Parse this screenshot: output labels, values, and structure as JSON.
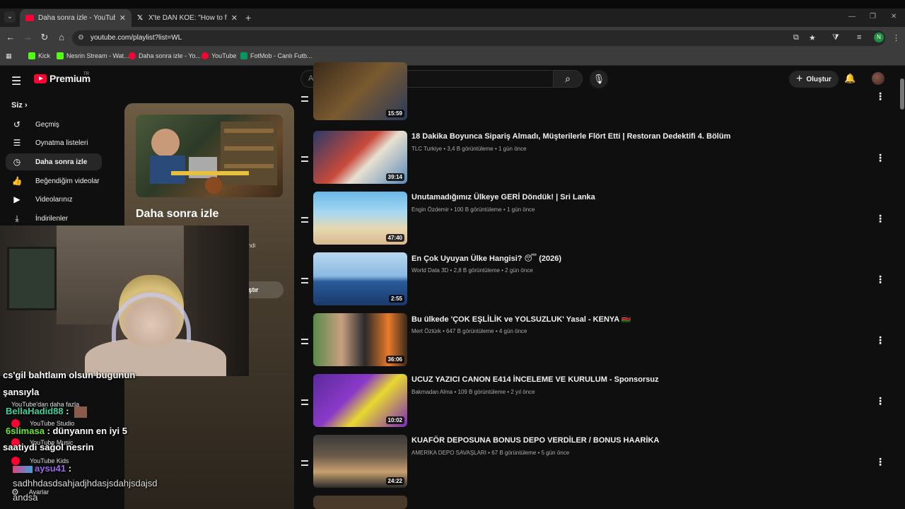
{
  "browser": {
    "tabs": [
      {
        "title": "Daha sonra izle - YouTube",
        "active": true
      },
      {
        "title": "X'te DAN KOE: \"How to fix your",
        "active": false
      }
    ],
    "url": "youtube.com/playlist?list=WL",
    "bookmarks": [
      "Kick",
      "Nesrin Stream - Wat...",
      "Daha sonra izle - Yo...",
      "YouTube",
      "FotMob - Canlı Futb..."
    ],
    "profile_initial": "N"
  },
  "youtube": {
    "logo": "Premium",
    "logo_region": "TR",
    "search_placeholder": "Ara",
    "create_label": "Oluştur",
    "sidebar": {
      "section": "Siz",
      "items": [
        {
          "label": "Geçmiş",
          "icon": "history-icon"
        },
        {
          "label": "Oynatma listeleri",
          "icon": "playlist-icon"
        },
        {
          "label": "Daha sonra izle",
          "icon": "clock-icon",
          "active": true
        },
        {
          "label": "Beğendiğim videolar",
          "icon": "thumbs-up-icon"
        },
        {
          "label": "Videolarınız",
          "icon": "video-icon"
        },
        {
          "label": "İndirilenler",
          "icon": "download-icon"
        }
      ],
      "more_from": "YouTube'dan daha fazla",
      "sub_items": [
        "YouTube Studio",
        "YouTube Music",
        "YouTube Kids"
      ],
      "settings": "Ayarlar"
    },
    "playlist": {
      "title": "Daha sonra izle",
      "meta_fragment": "endi",
      "shuffle_fragment": "ıştır"
    },
    "videos": [
      {
        "title": "",
        "meta": "",
        "duration": "15:59"
      },
      {
        "title": "18 Dakika Boyunca Sipariş Almadı, Müşterilerle Flört Etti | Restoran Dedektifi 4. Bölüm",
        "meta": "TLC Turkiye • 3,4 B görüntüleme • 1 gün önce",
        "duration": "39:14"
      },
      {
        "title": "Unutamadığımız Ülkeye GERİ Döndük! | Sri Lanka",
        "meta": "Engin Özdemir • 100 B görüntüleme • 1 gün önce",
        "duration": "47:40"
      },
      {
        "title": "En Çok Uyuyan Ülke Hangisi? 😴 (2026)",
        "meta": "World Data 3D • 2,8 B görüntüleme • 2 gün önce",
        "duration": "2:55"
      },
      {
        "title": "Bu ülkede 'ÇOK EŞLİLİK ve YOLSUZLUK' Yasal - KENYA 🇰🇪",
        "meta": "Mert Öztürk • 647 B görüntüleme • 4 gün önce",
        "duration": "36:06"
      },
      {
        "title": "UCUZ YAZICI CANON E414 İNCELEME VE KURULUM - Sponsorsuz",
        "meta": "Bakmadan Alma • 109 B görüntüleme • 2 yıl önce",
        "duration": "10:02"
      },
      {
        "title": "KUAFÖR DEPOSUNA BONUS DEPO VERDİLER / BONUS HAARİKA",
        "meta": "AMERİKA DEPO SAVAŞLARI • 67 B görüntüleme • 5 gün önce",
        "duration": "24:22"
      }
    ]
  },
  "stream_chat": [
    {
      "text": "cs'gil bahtlaım olsun bugunun"
    },
    {
      "text": "şansıyla"
    },
    {
      "nick": "BellaHadid88",
      "text": " : "
    },
    {
      "nick": "6slimasa",
      "text": " : dünyanın en iyi 5"
    },
    {
      "text": "saatiydi sağol nesrin"
    },
    {
      "nick": "aysu41",
      "text": " :"
    },
    {
      "text": "sadhhdasdsahjadjhdasjsdahjsdajsd"
    },
    {
      "text": "andsa"
    }
  ]
}
